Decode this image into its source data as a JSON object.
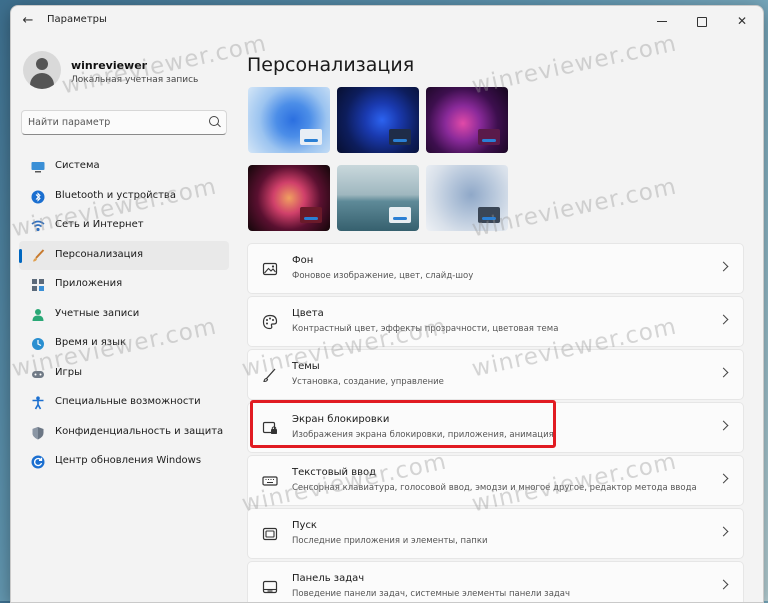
{
  "window": {
    "title": "Параметры",
    "back_glyph": "←",
    "close_glyph": "✕"
  },
  "profile": {
    "name": "winreviewer",
    "subtitle": "Локальная учетная запись"
  },
  "search": {
    "placeholder": "Найти параметр"
  },
  "sidebar": {
    "items": [
      {
        "label": "Система",
        "icon": "monitor-icon",
        "active": false
      },
      {
        "label": "Bluetooth и устройства",
        "icon": "bluetooth-icon",
        "active": false
      },
      {
        "label": "Сеть и Интернет",
        "icon": "wifi-icon",
        "active": false
      },
      {
        "label": "Персонализация",
        "icon": "brush-icon",
        "active": true
      },
      {
        "label": "Приложения",
        "icon": "apps-icon",
        "active": false
      },
      {
        "label": "Учетные записи",
        "icon": "person-icon",
        "active": false
      },
      {
        "label": "Время и язык",
        "icon": "globe-clock-icon",
        "active": false
      },
      {
        "label": "Игры",
        "icon": "gamepad-icon",
        "active": false
      },
      {
        "label": "Специальные возможности",
        "icon": "accessibility-icon",
        "active": false
      },
      {
        "label": "Конфиденциальность и защита",
        "icon": "shield-icon",
        "active": false
      },
      {
        "label": "Центр обновления Windows",
        "icon": "update-icon",
        "active": false
      }
    ]
  },
  "main": {
    "title": "Персонализация",
    "themes": [
      {
        "name": "theme-windows-light",
        "bg": "#7fb0e6"
      },
      {
        "name": "theme-windows-dark",
        "bg": "#0e1f4d"
      },
      {
        "name": "theme-glow",
        "bg": "#2a0a2a"
      },
      {
        "name": "theme-captured-motion",
        "bg": "#1a0d12"
      },
      {
        "name": "theme-sunrise",
        "bg": "#6f94a6"
      },
      {
        "name": "theme-flow",
        "bg": "#b8c6d8"
      }
    ],
    "cards": [
      {
        "title": "Фон",
        "subtitle": "Фоновое изображение, цвет, слайд-шоу",
        "icon": "image-icon"
      },
      {
        "title": "Цвета",
        "subtitle": "Контрастный цвет, эффекты прозрачности, цветовая тема",
        "icon": "palette-icon"
      },
      {
        "title": "Темы",
        "subtitle": "Установка, создание, управление",
        "icon": "pen-icon"
      },
      {
        "title": "Экран блокировки",
        "subtitle": "Изображения экрана блокировки, приложения, анимация",
        "icon": "lock-screen-icon"
      },
      {
        "title": "Текстовый ввод",
        "subtitle": "Сенсорная клавиатура, голосовой ввод, эмодзи и многое другое, редактор метода ввода",
        "icon": "keyboard-icon"
      },
      {
        "title": "Пуск",
        "subtitle": "Последние приложения и элементы, папки",
        "icon": "start-icon"
      },
      {
        "title": "Панель задач",
        "subtitle": "Поведение панели задач, системные элементы панели задач",
        "icon": "taskbar-icon"
      }
    ]
  },
  "watermark": "winreviewer.com",
  "colors": {
    "accent": "#0067c0",
    "highlight": "#e11b22",
    "window_bg": "#f3f3f3",
    "card_bg": "#fbfbfb"
  }
}
